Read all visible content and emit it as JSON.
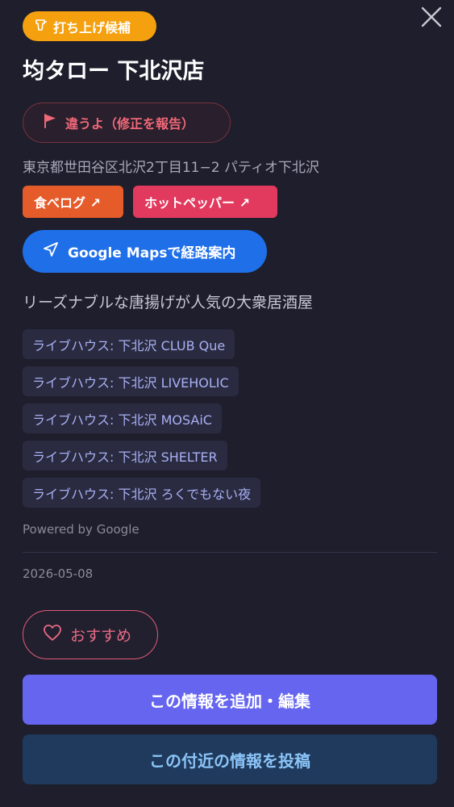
{
  "colors": {
    "background": "#1e1e2c",
    "badge": "#f5a00e",
    "report_text": "#f06878",
    "tabelog": "#e55b2a",
    "hotpepper": "#e23a5e",
    "maps": "#1f6fe8",
    "tag_text": "#a8b0f4",
    "recommend": "#e86a86",
    "primary": "#6565f0",
    "secondary": "#1f3a5c"
  },
  "header": {
    "badge_icon": "party-cannon-icon",
    "badge_label": "打ち上げ候補",
    "close_icon": "close-icon",
    "title": "均タロー 下北沢店"
  },
  "report": {
    "icon": "flag-icon",
    "label": "違うよ（修正を報告）"
  },
  "address": "東京都世田谷区北沢2丁目11−2 パティオ下北沢",
  "external_links": [
    {
      "label": "食べログ ↗"
    },
    {
      "label": "ホットペッパー ↗"
    }
  ],
  "maps": {
    "icon": "navigation-arrow-icon",
    "label": "Google Mapsで経路案内"
  },
  "description": "リーズナブルな唐揚げが人気の大衆居酒屋",
  "tags": [
    {
      "label": "ライブハウス: 下北沢 CLUB Que"
    },
    {
      "label": "ライブハウス: 下北沢 LIVEHOLIC"
    },
    {
      "label": "ライブハウス: 下北沢 MOSAiC"
    },
    {
      "label": "ライブハウス: 下北沢 SHELTER"
    },
    {
      "label": "ライブハウス: 下北沢 ろくでもない夜"
    }
  ],
  "attribution": "Powered by Google",
  "date": "2026-05-08",
  "recommend": {
    "icon": "heart-icon",
    "label": "おすすめ"
  },
  "actions": {
    "edit_label": "この情報を追加・編集",
    "post_nearby_label": "この付近の情報を投稿"
  }
}
